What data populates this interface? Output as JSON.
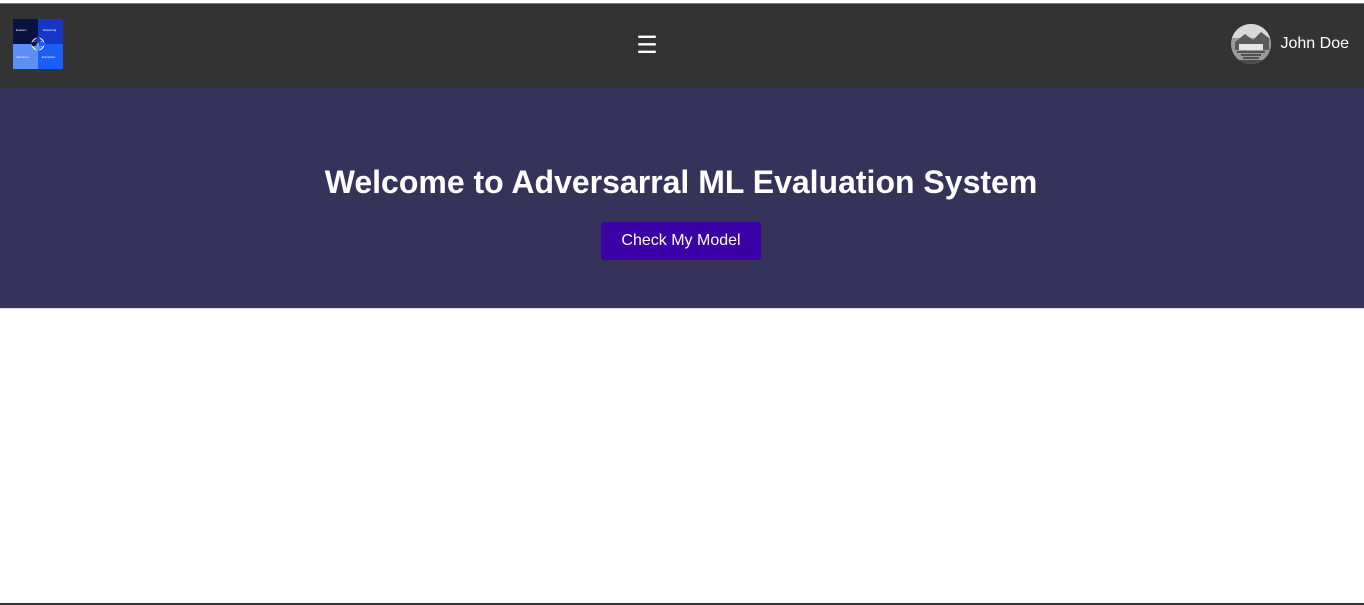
{
  "navbar": {
    "logo_words": [
      "Evasion",
      "Poisoning",
      "Inference",
      "Extraction"
    ],
    "menu_icon": "hamburger-icon",
    "user": {
      "name": "John Doe",
      "avatar_icon": "avatar-image"
    }
  },
  "hero": {
    "title": "Welcome to Adversarral ML Evaluation System",
    "cta_label": "Check My Model"
  },
  "colors": {
    "navbar_bg": "#333333",
    "hero_bg": "#35335a",
    "cta_bg": "#3b00a6",
    "text": "#ffffff"
  }
}
